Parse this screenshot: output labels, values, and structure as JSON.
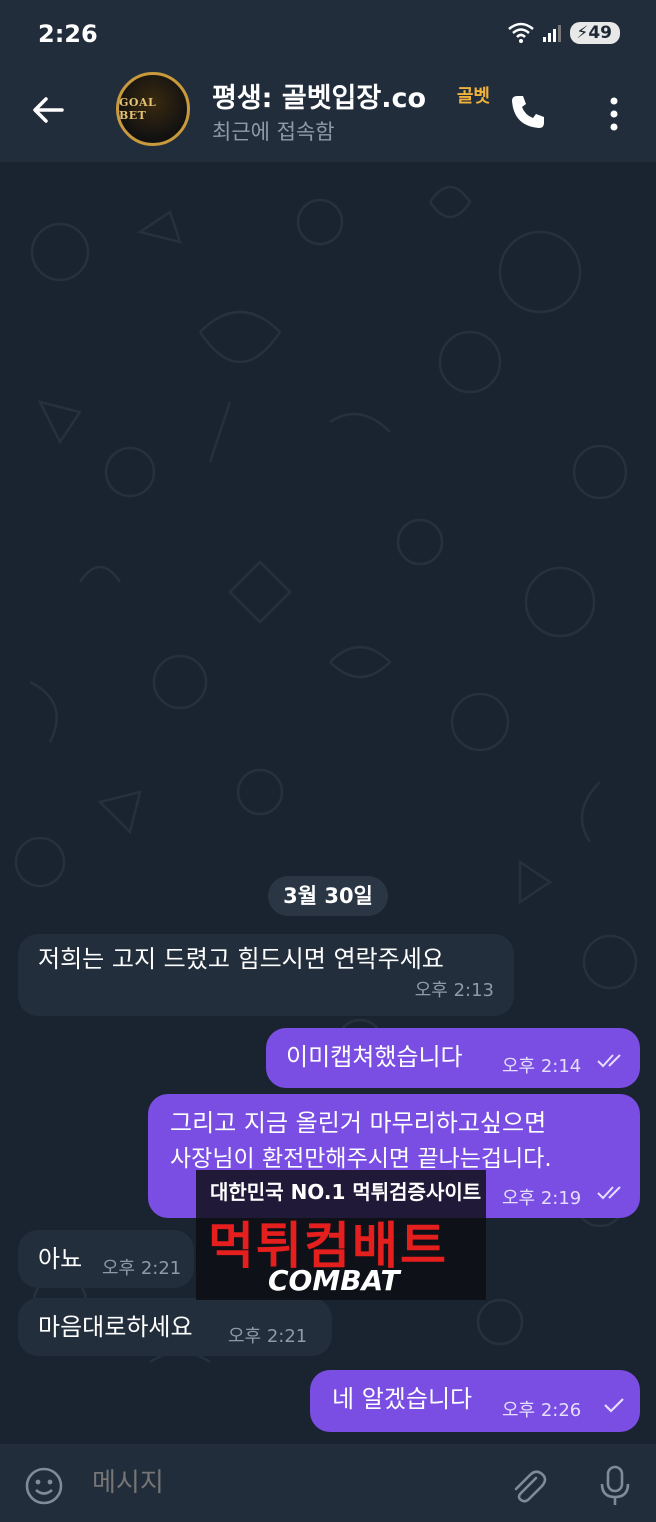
{
  "status_bar": {
    "time": "2:26",
    "battery": "49"
  },
  "header": {
    "title": "평생: 골벳입장.co",
    "title_badge": "골벳",
    "subtitle": "최근에 접속함",
    "avatar_text": "GOAL BET"
  },
  "chat": {
    "date_separator": "3월 30일",
    "messages": [
      {
        "dir": "in",
        "text": "저희는 고지 드렸고 힘드시면 연락주세요",
        "time": "오후 2:13"
      },
      {
        "dir": "out",
        "text": "이미캡쳐했습니다",
        "time": "오후 2:14",
        "status": "read"
      },
      {
        "dir": "out",
        "line1": "그리고 지금 올린거 마무리하고싶으면",
        "line2": "사장님이 환전만해주시면 끝나는겁니다.",
        "time": "오후 2:19",
        "status": "read"
      },
      {
        "dir": "in",
        "text": "아뇨",
        "time": "오후 2:21"
      },
      {
        "dir": "in",
        "text": "마음대로하세요",
        "time": "오후 2:21"
      },
      {
        "dir": "out",
        "text": "네 알겠습니다",
        "time": "오후 2:26",
        "status": "sent"
      }
    ]
  },
  "watermark": {
    "line1": "대한민국 NO.1 먹튀검증사이트",
    "line2": "먹튀컴배트",
    "line3": "COMBAT"
  },
  "input": {
    "placeholder": "메시지"
  },
  "colors": {
    "outgoing_bubble": "#7a4ee3",
    "incoming_bubble": "#222e3b",
    "header_bg": "#212d3b",
    "chat_bg": "#1a2430"
  }
}
